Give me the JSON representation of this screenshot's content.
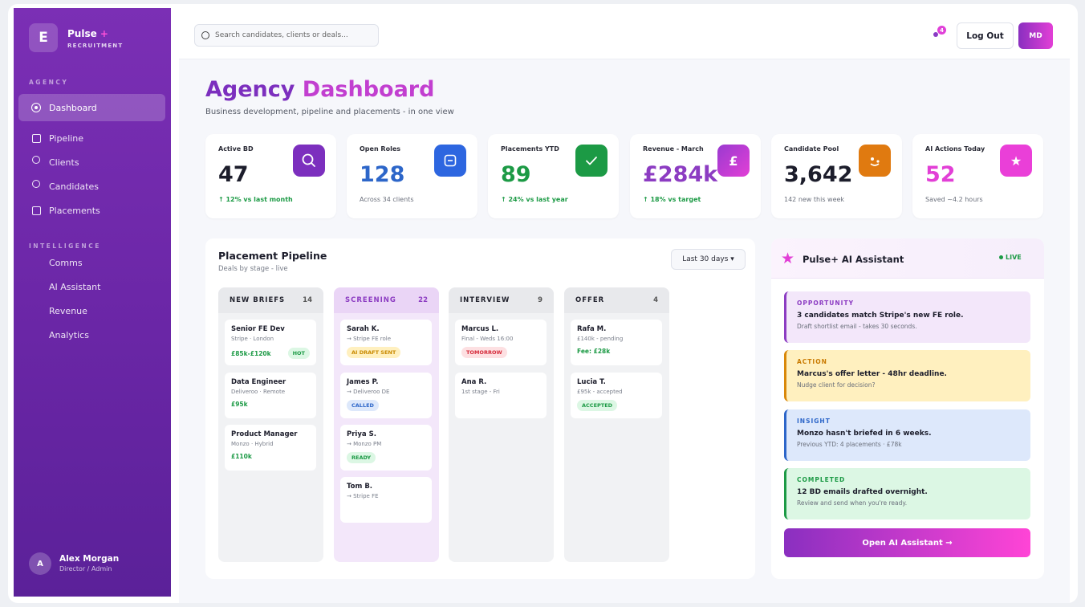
{
  "sidebar": {
    "logo_letter": "E",
    "brand_name": "Pulse",
    "brand_plus": "+",
    "brand_sub": "RECRUITMENT",
    "section_agency": "AGENCY",
    "section_intelligence": "INTELLIGENCE",
    "items": [
      {
        "label": "Dashboard"
      },
      {
        "label": "Pipeline"
      },
      {
        "label": "Clients"
      },
      {
        "label": "Candidates"
      },
      {
        "label": "Placements"
      },
      {
        "label": "Comms"
      },
      {
        "label": "AI Assistant"
      },
      {
        "label": "Revenue"
      },
      {
        "label": "Analytics"
      }
    ],
    "user": {
      "initial": "A",
      "name": "Alex Morgan",
      "role": "Director / Admin"
    }
  },
  "topbar": {
    "search_placeholder": "Search candidates, clients or deals...",
    "notification_count": "4",
    "logout_label": "Log Out",
    "profile_initials": "MD"
  },
  "header": {
    "title_part1": "Agency",
    "title_part2": "Dashboard",
    "subtitle": "Business development, pipeline and placements - in one view"
  },
  "kpis": [
    {
      "label": "Active BD",
      "value": "47",
      "note": "↑ 12% vs last month",
      "color": "#1c1d2b",
      "icon": "search-icon"
    },
    {
      "label": "Open Roles",
      "value": "128",
      "note": "Across 34 clients",
      "color": "#2d66c9",
      "icon": "briefcase-icon"
    },
    {
      "label": "Placements YTD",
      "value": "89",
      "note": "↑ 24% vs last year",
      "color": "#1c9a45",
      "icon": "check-icon"
    },
    {
      "label": "Revenue - March",
      "value": "£284k",
      "note": "↑ 18% vs target",
      "color": "#8c3cc2",
      "icon_text": "£"
    },
    {
      "label": "Candidate Pool",
      "value": "3,642",
      "note": "142 new this week",
      "color": "#1c1d2b",
      "icon": "smiley-icon"
    },
    {
      "label": "AI Actions Today",
      "value": "52",
      "note": "Saved ~4.2 hours",
      "color": "#e23fd6",
      "icon_text": "★"
    }
  ],
  "pipeline": {
    "title": "Placement Pipeline",
    "subtitle": "Deals by stage - live",
    "range_label": "Last 30 days ▾",
    "columns": [
      {
        "name": "NEW BRIEFS",
        "count": "14",
        "cards": [
          {
            "title": "Senior FE Dev",
            "sub": "Stripe · London",
            "salary": "£85k-£120k",
            "tag": "HOT"
          },
          {
            "title": "Data Engineer",
            "sub": "Deliveroo · Remote",
            "salary": "£95k"
          },
          {
            "title": "Product Manager",
            "sub": "Monzo · Hybrid",
            "salary": "£110k"
          }
        ]
      },
      {
        "name": "SCREENING",
        "count": "22",
        "cards": [
          {
            "title": "Sarah K.",
            "sub": "→ Stripe FE role",
            "tag": "AI DRAFT SENT"
          },
          {
            "title": "James P.",
            "sub": "→ Deliveroo DE",
            "tag": "CALLED"
          },
          {
            "title": "Priya S.",
            "sub": "→ Monzo PM",
            "tag": "READY"
          },
          {
            "title": "Tom B.",
            "sub": "→ Stripe FE"
          }
        ]
      },
      {
        "name": "INTERVIEW",
        "count": "9",
        "cards": [
          {
            "title": "Marcus L.",
            "sub": "Final - Weds 16:00",
            "tag": "TOMORROW"
          },
          {
            "title": "Ana R.",
            "sub": "1st stage - Fri"
          }
        ]
      },
      {
        "name": "OFFER",
        "count": "4",
        "cards": [
          {
            "title": "Rafa M.",
            "sub": "£140k - pending",
            "salary": "Fee: £28k"
          },
          {
            "title": "Lucia T.",
            "sub": "£95k - accepted",
            "tag": "ACCEPTED"
          }
        ]
      }
    ]
  },
  "ai": {
    "title": "Pulse+ AI Assistant",
    "status": "LIVE",
    "cards": [
      {
        "kind": "OPPORTUNITY",
        "text": "3 candidates match Stripe's new FE role.",
        "sub": "Draft shortlist email - takes 30 seconds."
      },
      {
        "kind": "ACTION",
        "text": "Marcus's offer letter - 48hr deadline.",
        "sub": "Nudge client for decision?"
      },
      {
        "kind": "INSIGHT",
        "text": "Monzo hasn't briefed in 6 weeks.",
        "sub": "Previous YTD: 4 placements · £78k"
      },
      {
        "kind": "COMPLETED",
        "text": "12 BD emails drafted overnight.",
        "sub": "Review and send when you're ready."
      }
    ],
    "button_label": "Open AI Assistant →"
  }
}
